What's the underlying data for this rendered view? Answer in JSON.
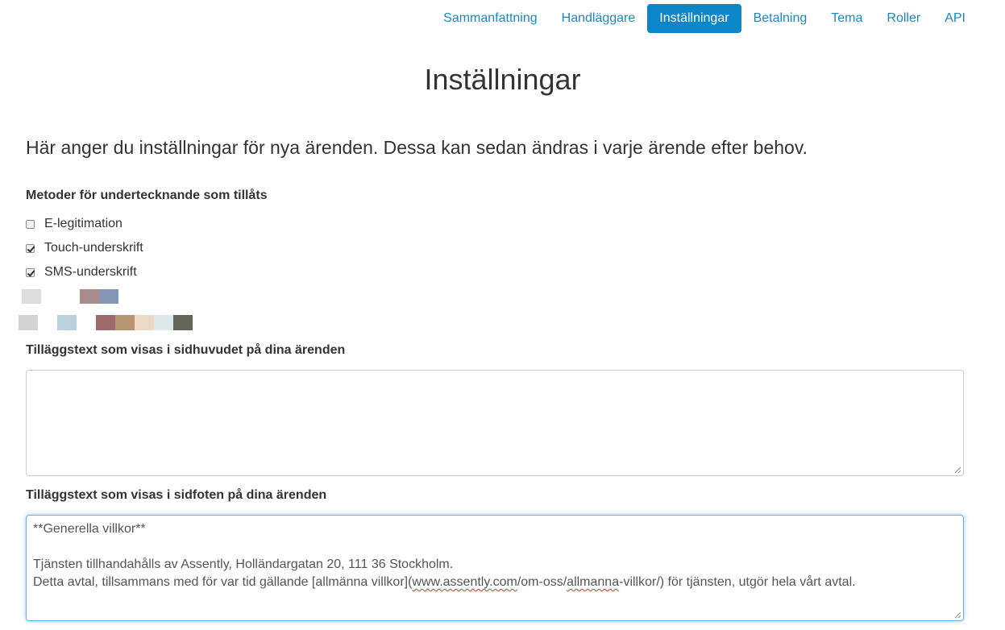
{
  "nav": {
    "items": [
      {
        "label": "Sammanfattning",
        "active": false
      },
      {
        "label": "Handläggare",
        "active": false
      },
      {
        "label": "Inställningar",
        "active": true
      },
      {
        "label": "Betalning",
        "active": false
      },
      {
        "label": "Tema",
        "active": false
      },
      {
        "label": "Roller",
        "active": false
      },
      {
        "label": "API",
        "active": false
      }
    ]
  },
  "page": {
    "title": "Inställningar",
    "lead": "Här anger du inställningar för nya ärenden. Dessa kan sedan ändras i varje ärende efter behov."
  },
  "signing": {
    "label": "Metoder för undertecknande som tillåts",
    "options": [
      {
        "label": "E-legitimation",
        "checked": false
      },
      {
        "label": "Touch-underskrift",
        "checked": true
      },
      {
        "label": "SMS-underskrift",
        "checked": true
      }
    ]
  },
  "swatches": {
    "row1": [
      "#dcdcdc",
      "#a88a8a",
      "#8295b5"
    ],
    "row2": [
      "#d3d3d3",
      "#b9d3de",
      "#9b6b6e",
      "#b59572",
      "#ecd9c4",
      "#dde8e8",
      "#626359"
    ]
  },
  "header_text": {
    "label": "Tilläggstext som visas i sidhuvudet på dina ärenden",
    "value": ""
  },
  "footer_text": {
    "label": "Tilläggstext som visas i sidfoten på dina ärenden",
    "line1": "**Generella villkor**",
    "line2": "",
    "line3": "Tjänsten tillhandahålls av Assently, Holländargatan 20, 111 36 Stockholm.",
    "line4_a": "Detta avtal, tillsammans med för var tid gällande [allmänna villkor](",
    "line4_link": "www.assently.com",
    "line4_b": "/om-oss/",
    "line4_misspelled": "allmanna",
    "line4_c": "-villkor/) för tjänsten, utgör hela vårt avtal."
  },
  "colors": {
    "accent": "#0a86c9",
    "link": "#1f87c0",
    "focus": "#66afe9"
  }
}
